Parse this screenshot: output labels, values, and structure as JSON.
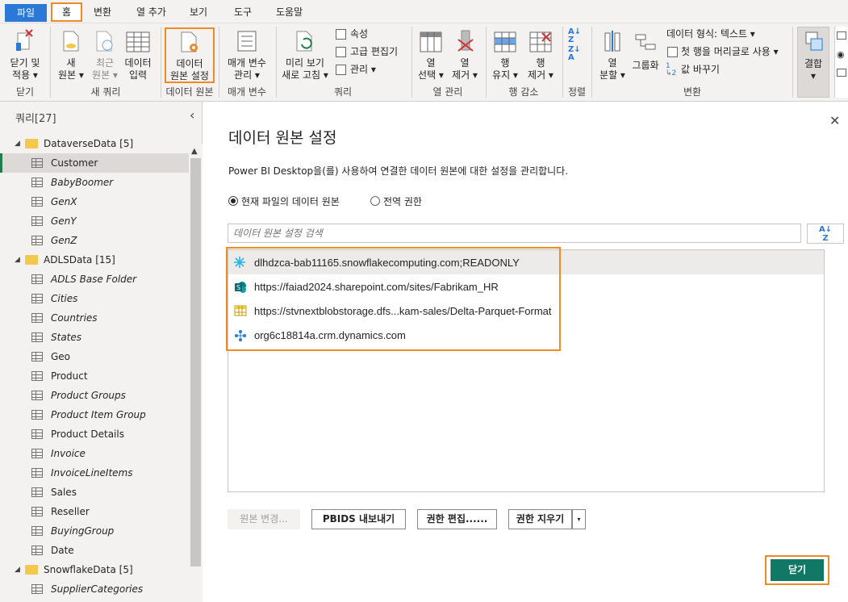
{
  "menu": {
    "file": "파일",
    "home": "홈",
    "transform": "변환",
    "add_column": "열 추가",
    "view": "보기",
    "tools": "도구",
    "help": "도움말"
  },
  "ribbon": {
    "close_apply_1": "닫기 및",
    "close_apply_2": "적용 ▾",
    "close_group": "닫기",
    "new_source_1": "새",
    "new_source_2": "원본 ▾",
    "recent_source_1": "최근",
    "recent_source_2": "원본 ▾",
    "enter_data_1": "데이터",
    "enter_data_2": "입력",
    "new_query_group": "새 쿼리",
    "ds_settings_1": "데이터",
    "ds_settings_2": "원본 설정",
    "ds_group": "데이터 원본",
    "manage_params_1": "매개 변수",
    "manage_params_2": "관리 ▾",
    "params_group": "매개 변수",
    "refresh_1": "미리 보기",
    "refresh_2": "새로 고침 ▾",
    "properties": "속성",
    "advanced_editor": "고급 편집기",
    "manage": "관리 ▾",
    "query_group": "쿼리",
    "choose_cols_1": "열",
    "choose_cols_2": "선택 ▾",
    "remove_cols_1": "열",
    "remove_cols_2": "제거 ▾",
    "manage_cols_group": "열 관리",
    "keep_rows_1": "행",
    "keep_rows_2": "유지 ▾",
    "remove_rows_1": "행",
    "remove_rows_2": "제거 ▾",
    "reduce_rows_group": "행 감소",
    "sort_group": "정렬",
    "split_col_1": "열",
    "split_col_2": "분할 ▾",
    "group_by": "그룹화",
    "data_type": "데이터 형식: 텍스트 ▾",
    "first_row_header": "첫 행을 머리글로 사용 ▾",
    "replace_values": "값 바꾸기",
    "transform_group": "변환",
    "combine_1": "결합",
    "combine_2": "▾"
  },
  "queries": {
    "header": "쿼리[27]",
    "items": [
      {
        "label": "DataverseData [5]",
        "type": "folder"
      },
      {
        "label": "Customer",
        "type": "table",
        "italic": false,
        "selected": true
      },
      {
        "label": "BabyBoomer",
        "type": "table",
        "italic": true
      },
      {
        "label": "GenX",
        "type": "table",
        "italic": true
      },
      {
        "label": "GenY",
        "type": "table",
        "italic": true
      },
      {
        "label": "GenZ",
        "type": "table",
        "italic": true
      },
      {
        "label": "ADLSData [15]",
        "type": "folder"
      },
      {
        "label": "ADLS Base Folder",
        "type": "table",
        "italic": true
      },
      {
        "label": "Cities",
        "type": "table",
        "italic": true
      },
      {
        "label": "Countries",
        "type": "table",
        "italic": true
      },
      {
        "label": "States",
        "type": "table",
        "italic": true
      },
      {
        "label": "Geo",
        "type": "table",
        "italic": false
      },
      {
        "label": "Product",
        "type": "table",
        "italic": false
      },
      {
        "label": "Product Groups",
        "type": "table",
        "italic": true
      },
      {
        "label": "Product Item Group",
        "type": "table",
        "italic": true
      },
      {
        "label": "Product Details",
        "type": "table",
        "italic": false
      },
      {
        "label": "Invoice",
        "type": "table",
        "italic": true
      },
      {
        "label": "InvoiceLineItems",
        "type": "table",
        "italic": true
      },
      {
        "label": "Sales",
        "type": "table",
        "italic": false
      },
      {
        "label": "Reseller",
        "type": "table",
        "italic": false
      },
      {
        "label": "BuyingGroup",
        "type": "table",
        "italic": true
      },
      {
        "label": "Date",
        "type": "table",
        "italic": false
      },
      {
        "label": "SnowflakeData [5]",
        "type": "folder"
      },
      {
        "label": "SupplierCategories",
        "type": "table",
        "italic": true
      }
    ]
  },
  "dialog": {
    "title": "데이터 원본 설정",
    "description": "Power BI Desktop을(를) 사용하여 연결한 데이터 원본에 대한 설정을 관리합니다.",
    "radio_current": "현재 파일의 데이터 원본",
    "radio_global": "전역 권한",
    "search_placeholder": "데이터 원본 설정 검색",
    "sources": [
      {
        "label": "dlhdzca-bab11165.snowflakecomputing.com;READONLY",
        "icon": "snowflake-icon"
      },
      {
        "label": "https://faiad2024.sharepoint.com/sites/Fabrikam_HR",
        "icon": "sharepoint-icon"
      },
      {
        "label": "https://stvnextblobstorage.dfs...kam-sales/Delta-Parquet-Format",
        "icon": "table-source-icon"
      },
      {
        "label": "org6c18814a.crm.dynamics.com",
        "icon": "dataverse-icon"
      }
    ],
    "change_source": "원본 변경...",
    "export_pbids": "PBIDS 내보내기",
    "edit_permissions": "권한 편집......",
    "clear_permissions": "권한 지우기",
    "close": "닫기"
  }
}
